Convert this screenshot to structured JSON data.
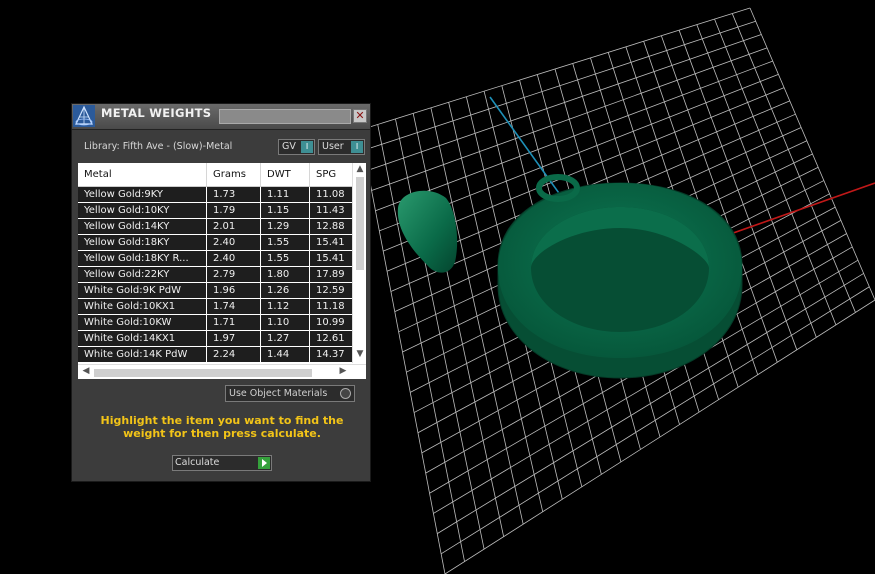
{
  "panel": {
    "title": "METAL WEIGHTS",
    "close_symbol": "✕",
    "library_label": "Library: Fifth Ave - (Slow)-Metal",
    "toggles": [
      {
        "label": "GV"
      },
      {
        "label": "User"
      }
    ],
    "table": {
      "columns": [
        "Metal",
        "Grams",
        "DWT",
        "SPG"
      ],
      "rows": [
        {
          "metal": "Yellow Gold:9KY",
          "grams": "1.73",
          "dwt": "1.11",
          "spg": "11.08"
        },
        {
          "metal": "Yellow Gold:10KY",
          "grams": "1.79",
          "dwt": "1.15",
          "spg": "11.43"
        },
        {
          "metal": "Yellow Gold:14KY",
          "grams": "2.01",
          "dwt": "1.29",
          "spg": "12.88"
        },
        {
          "metal": "Yellow Gold:18KY",
          "grams": "2.40",
          "dwt": "1.55",
          "spg": "15.41"
        },
        {
          "metal": "Yellow Gold:18KY R...",
          "grams": "2.40",
          "dwt": "1.55",
          "spg": "15.41"
        },
        {
          "metal": "Yellow Gold:22KY",
          "grams": "2.79",
          "dwt": "1.80",
          "spg": "17.89"
        },
        {
          "metal": "White Gold:9K PdW",
          "grams": "1.96",
          "dwt": "1.26",
          "spg": "12.59"
        },
        {
          "metal": "White Gold:10KX1",
          "grams": "1.74",
          "dwt": "1.12",
          "spg": "11.18"
        },
        {
          "metal": "White Gold:10KW",
          "grams": "1.71",
          "dwt": "1.10",
          "spg": "10.99"
        },
        {
          "metal": "White Gold:14KX1",
          "grams": "1.97",
          "dwt": "1.27",
          "spg": "12.61"
        },
        {
          "metal": "White Gold:14K PdW",
          "grams": "2.24",
          "dwt": "1.44",
          "spg": "14.37"
        }
      ]
    },
    "use_object_materials_label": "Use Object Materials",
    "instructions": "Highlight the item you want to find the weight for then press calculate.",
    "calculate_label": "Calculate"
  },
  "colors": {
    "background": "#000000",
    "grid": "#bfbfbf",
    "model": "#0a6a4a",
    "x_axis": "#c01818",
    "y_axis": "#1e90b8",
    "instruction_text": "#f2c418",
    "toggle_knob": "#3e8f94",
    "calculate_go": "#35a13c"
  },
  "icons": {
    "app": "jewelry-cad-logo-icon",
    "close": "close-icon",
    "calculate": "play-arrow-icon",
    "scroll_up": "chevron-up-icon",
    "scroll_down": "chevron-down-icon",
    "scroll_left": "chevron-left-icon",
    "scroll_right": "chevron-right-icon"
  }
}
